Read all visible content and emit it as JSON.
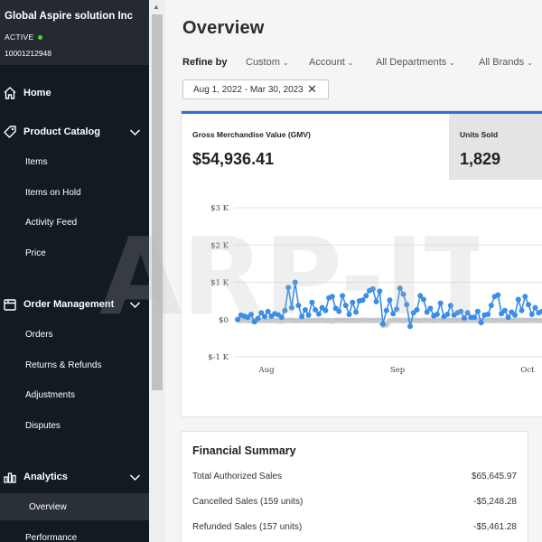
{
  "sidebar": {
    "org_name": "Global Aspire solution Inc",
    "status": "ACTIVE",
    "org_id": "10001212948",
    "sections": {
      "home": "Home",
      "catalog": "Product Catalog",
      "orders": "Order Management",
      "analytics": "Analytics"
    },
    "catalog_items": [
      "Items",
      "Items on Hold",
      "Activity Feed",
      "Price"
    ],
    "order_items": [
      "Orders",
      "Returns & Refunds",
      "Adjustments",
      "Disputes"
    ],
    "analytics_items": [
      "Overview",
      "Performance"
    ],
    "colors": {
      "background": "#121a22",
      "active_item": "#2a3038",
      "status_dot": "#4cd137"
    }
  },
  "main": {
    "title": "Overview",
    "refine_label": "Refine by",
    "filters": [
      "Custom",
      "Account",
      "All Departments",
      "All Brands"
    ],
    "date_range": "Aug 1, 2022 - Mar 30, 2023",
    "date_clear_icon": "close-icon",
    "metrics": {
      "gmv_label": "Gross Merchandise Value (GMV)",
      "gmv_value": "$54,936.41",
      "units_label": "Units Sold",
      "units_value": "1,829"
    },
    "financial": {
      "title": "Financial Summary",
      "rows": [
        {
          "label": "Total Authorized Sales",
          "amount": "$65,645.97"
        },
        {
          "label": "Cancelled Sales (159 units)",
          "amount": "-$5,248.28"
        },
        {
          "label": "Refunded Sales (157 units)",
          "amount": "-$5,461.28"
        }
      ]
    }
  },
  "watermark": {
    "text": "ARP-IT"
  },
  "chart_data": {
    "type": "line",
    "y_tick_labels": [
      "$3 K",
      "$2 K",
      "$1 K",
      "$0",
      "$-1 K"
    ],
    "x_tick_labels": [
      "Aug",
      "Sep",
      "Oct"
    ],
    "ylim": [
      -1000,
      3000
    ],
    "grid": true,
    "series": [
      {
        "color": "#3a8ee6",
        "values": [
          0,
          120,
          90,
          60,
          140,
          -60,
          30,
          180,
          80,
          220,
          90,
          160,
          130,
          60,
          240,
          860,
          320,
          1000,
          380,
          80,
          260,
          120,
          460,
          260,
          150,
          320,
          240,
          580,
          620,
          300,
          220,
          640,
          380,
          140,
          460,
          200,
          500,
          520,
          640,
          780,
          820,
          480,
          760,
          -120,
          240,
          520,
          160,
          280,
          840,
          680,
          400,
          -180,
          180,
          260,
          640,
          540,
          200,
          300,
          100,
          140,
          440,
          80,
          140,
          380,
          120,
          180,
          220,
          40,
          180,
          60,
          60,
          220,
          -80,
          120,
          140,
          380,
          620,
          660,
          160,
          240,
          60,
          200,
          120,
          540,
          240,
          620,
          400,
          140,
          320,
          180,
          220
        ]
      },
      {
        "color": "#9aa0a6",
        "values": [
          -20,
          -20,
          -20,
          -30,
          -30,
          -30,
          -20,
          -20,
          -20,
          -30,
          -20,
          -20,
          -30,
          -40,
          -20,
          -20,
          -20,
          -30,
          -30,
          -20,
          -20,
          -20,
          -30,
          -20,
          -20,
          -20,
          -30,
          -30,
          -40,
          -20,
          -20,
          -20,
          -30,
          -20,
          -20,
          -30,
          -20,
          -20,
          -20,
          -20,
          -30,
          -20,
          -20,
          -150,
          -140,
          -30,
          -20,
          -20,
          -20,
          -30,
          -20,
          -20,
          -20,
          -20,
          -30,
          -20,
          -20,
          -20,
          -30,
          -20,
          -20,
          -20,
          -20,
          -30,
          -20,
          -20,
          -20,
          -30,
          -20,
          -20,
          -20,
          -20,
          -30,
          -20,
          -20,
          -20,
          -30,
          -20,
          -20,
          -20,
          -20,
          -30,
          -20,
          -20,
          -20,
          -30,
          -20,
          -20,
          -20,
          -30,
          -20
        ]
      }
    ]
  }
}
